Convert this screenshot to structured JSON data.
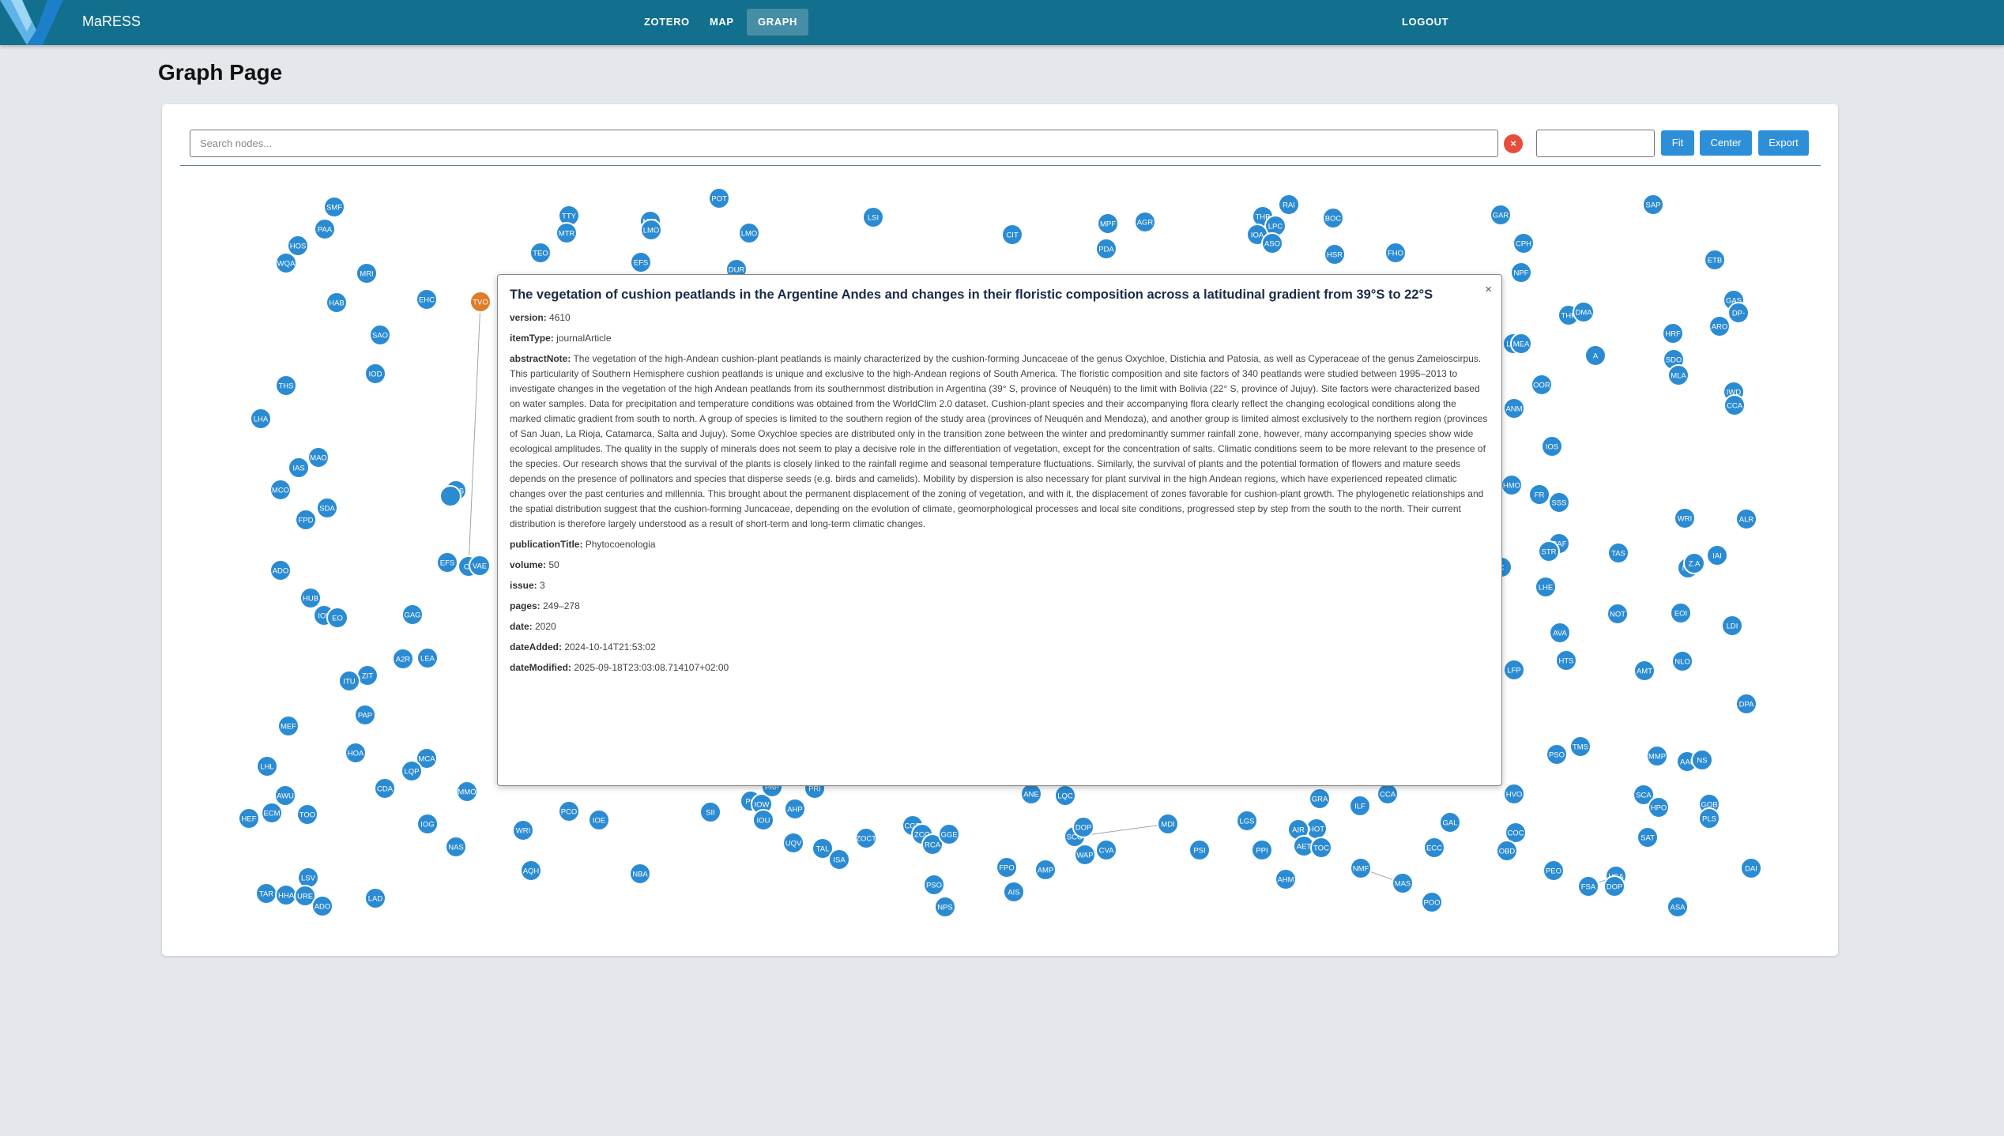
{
  "app": {
    "name": "MaRESS"
  },
  "nav": {
    "zotero": "ZOTERO",
    "map": "MAP",
    "graph": "GRAPH",
    "logout": "LOGOUT"
  },
  "page": {
    "title": "Graph Page"
  },
  "toolbar": {
    "search_placeholder": "Search nodes...",
    "clear": "×",
    "fit": "Fit",
    "center": "Center",
    "export": "Export"
  },
  "colors": {
    "topbar": "#126f8d",
    "node": "#2b8bd2",
    "node_highlight": "#e07b28",
    "button": "#2d8fd8",
    "clear": "#e74c3c"
  },
  "popup": {
    "close": "×",
    "title": "The vegetation of cushion peatlands in the Argentine Andes and changes in their floristic composition across a latitudinal gradient from 39°S to 22°S",
    "fields": [
      {
        "key": "version:",
        "value": "4610"
      },
      {
        "key": "itemType:",
        "value": "journalArticle"
      },
      {
        "key": "abstractNote:",
        "value": "The vegetation of the high-Andean cushion-plant peatlands is mainly characterized by the cushion-forming Juncaceae of the genus Oxychloe, Distichia and Patosia, as well as Cyperaceae of the genus Zameioscirpus. This particularity of Southern Hemisphere cushion peatlands is unique and exclusive to the high-Andean regions of South America. The floristic composition and site factors of 340 peatlands were studied between 1995–2013 to investigate changes in the vegetation of the high Andean peatlands from its southernmost distribution in Argentina (39° S, province of Neuquén) to the limit with Bolivia (22° S, province of Jujuy). Site factors were characterized based on water samples. Data for precipitation and temperature conditions was obtained from the WorldClim 2.0 dataset. Cushion-plant species and their accompanying flora clearly reflect the changing ecological conditions along the marked climatic gradient from south to north. A group of species is limited to the southern region of the study area (provinces of Neuquén and Mendoza), and another group is limited almost exclusively to the northern region (provinces of San Juan, La Rioja, Catamarca, Salta and Jujuy). Some Oxychloe species are distributed only in the transition zone between the winter and predominantly summer rainfall zone, however, many accompanying species show wide ecological amplitudes. The quality in the supply of minerals does not seem to play a decisive role in the differentiation of vegetation, except for the concentration of salts. Climatic conditions seem to be more relevant to the presence of the species. Our research shows that the survival of the plants is closely linked to the rainfall regime and seasonal temperature fluctuations. Similarly, the survival of plants and the potential formation of flowers and mature seeds depends on the presence of pollinators and species that disperse seeds (e.g. birds and camelids). Mobility by dispersion is also necessary for plant survival in the high Andean regions, which have experienced repeated climatic changes over the past centuries and millennia. This brought about the permanent displacement of the zoning of vegetation, and with it, the displacement of zones favorable for cushion-plant growth. The phylogenetic relationships and the spatial distribution suggest that the cushion-forming Juncaceae, depending on the evolution of climate, geomorphological processes and local site conditions, progressed step by step from the south to the north. Their current distribution is therefore largely understood as a result of short-term and long-term climatic changes."
      },
      {
        "key": "publicationTitle:",
        "value": "Phytocoenologia"
      },
      {
        "key": "volume:",
        "value": "50"
      },
      {
        "key": "issue:",
        "value": "3"
      },
      {
        "key": "pages:",
        "value": "249–278"
      },
      {
        "key": "date:",
        "value": "2020"
      },
      {
        "key": "dateAdded:",
        "value": "2024-10-14T21:53:02"
      },
      {
        "key": "dateModified:",
        "value": "2025-09-18T23:03:08.714107+02:00"
      }
    ]
  },
  "graph_nodes": [
    [
      "SMF",
      0,
      0
    ],
    [
      "PAA",
      0,
      0
    ],
    [
      "HOS",
      0,
      0
    ],
    [
      "WQA",
      0,
      0
    ],
    [
      "MRI",
      0,
      0
    ],
    [
      "HAB",
      0,
      0
    ],
    [
      "EHC",
      0,
      0
    ],
    [
      "TVO",
      0,
      0,
      1
    ],
    [
      "SAO",
      0,
      0
    ],
    [
      "IOD",
      0,
      0
    ],
    [
      "THS",
      0,
      0
    ],
    [
      "LHA",
      0,
      0
    ],
    [
      "MAO",
      0,
      0
    ],
    [
      "IAS",
      0,
      0
    ],
    [
      "MCO",
      0,
      0
    ],
    [
      "SDA",
      0,
      0
    ],
    [
      "FPD",
      0,
      0
    ],
    [
      "AOS",
      0,
      0
    ],
    [
      "",
      0,
      0
    ],
    [
      "EFS",
      0,
      0
    ],
    [
      "CL",
      0,
      0
    ],
    [
      "VAE",
      0,
      0
    ],
    [
      "ADO",
      0,
      0
    ],
    [
      "HUB",
      0,
      0
    ],
    [
      "IOL",
      0,
      0
    ],
    [
      "EO",
      0,
      0
    ],
    [
      "GAG",
      0,
      0
    ],
    [
      "A2R",
      0,
      0
    ],
    [
      "LEA",
      0,
      0
    ],
    [
      "ZIT",
      0,
      0
    ],
    [
      "ITU",
      0,
      0
    ],
    [
      "PAP",
      0,
      0
    ],
    [
      "MEF",
      0,
      0
    ],
    [
      "HOA",
      0,
      0
    ],
    [
      "MCA",
      0,
      0
    ],
    [
      "LQP",
      0,
      0
    ],
    [
      "LHL",
      0,
      0
    ],
    [
      "CDA",
      0,
      0
    ],
    [
      "MMO",
      0,
      0
    ],
    [
      "AWU",
      0,
      0
    ],
    [
      "ECM",
      0,
      0
    ],
    [
      "TOO",
      0,
      0
    ],
    [
      "HEF",
      0,
      0
    ],
    [
      "IOG",
      0,
      0
    ],
    [
      "NAS",
      0,
      0
    ],
    [
      "LSV",
      0,
      0
    ],
    [
      "TAR",
      0,
      0
    ],
    [
      "HHA",
      0,
      0
    ],
    [
      "URE",
      0,
      0
    ],
    [
      "ADO",
      0,
      0
    ],
    [
      "LAD",
      0,
      0
    ],
    [
      "WRI",
      0,
      0
    ],
    [
      "AQH",
      0,
      0
    ],
    [
      "PCO",
      0,
      0
    ],
    [
      "IOE",
      0,
      0
    ],
    [
      "NBA",
      0,
      0
    ],
    [
      "SII",
      0,
      0
    ],
    [
      "TTY",
      0,
      0
    ],
    [
      "MTR",
      0,
      0
    ],
    [
      "TEO",
      0,
      0
    ],
    [
      "MTA",
      0,
      0
    ],
    [
      "LMO",
      0,
      0
    ],
    [
      "EFS",
      0,
      0
    ],
    [
      "POT",
      0,
      0
    ],
    [
      "LMO",
      0,
      0
    ],
    [
      "DUR",
      0,
      0
    ],
    [
      "LSI",
      0,
      0
    ],
    [
      "CIT",
      0,
      0
    ],
    [
      "MPF",
      0,
      0
    ],
    [
      "AGR",
      0,
      0
    ],
    [
      "PDA",
      0,
      0
    ],
    [
      "RAI",
      0,
      0
    ],
    [
      "THB",
      0,
      0
    ],
    [
      "LPC",
      0,
      0
    ],
    [
      "IOA",
      0,
      0
    ],
    [
      "ASO",
      0,
      0
    ],
    [
      "BOC",
      0,
      0
    ],
    [
      "HSR",
      0,
      0
    ],
    [
      "FHO",
      0,
      0
    ],
    [
      "GAR",
      0,
      0
    ],
    [
      "CPH",
      0,
      0
    ],
    [
      "NPF",
      0,
      0
    ],
    [
      "SAP",
      0,
      0
    ],
    [
      "ETB",
      0,
      0
    ],
    [
      "GAS",
      0,
      0
    ],
    [
      "DP-",
      0,
      0
    ],
    [
      "THP",
      0,
      0
    ],
    [
      "DMA",
      0,
      0
    ],
    [
      "ARO",
      0,
      0
    ],
    [
      "HRF",
      0,
      0
    ],
    [
      "LLC",
      0,
      0
    ],
    [
      "MEA",
      0,
      0
    ],
    [
      "A",
      0,
      0
    ],
    [
      "SDO",
      0,
      0
    ],
    [
      "MLA",
      0,
      0
    ],
    [
      "OOR",
      0,
      0
    ],
    [
      "IWD",
      0,
      0
    ],
    [
      "CCA",
      0,
      0
    ],
    [
      "ANM",
      0,
      0
    ],
    [
      "IOS",
      0,
      0
    ],
    [
      "HMO",
      0,
      0
    ],
    [
      "FR",
      0,
      0
    ],
    [
      "SSS",
      0,
      0
    ],
    [
      "WRI",
      0,
      0
    ],
    [
      "ALR",
      0,
      0
    ],
    [
      "CAF",
      0,
      0
    ],
    [
      "STR",
      0,
      0
    ],
    [
      "TAS",
      0,
      0
    ],
    [
      "IAI",
      0,
      0
    ],
    [
      "NLI",
      0,
      0
    ],
    [
      "Z.A",
      0,
      0
    ],
    [
      "C",
      0,
      0
    ],
    [
      "LHE",
      0,
      0
    ],
    [
      "NOT",
      0,
      0
    ],
    [
      "EOI",
      0,
      0
    ],
    [
      "AVA",
      0,
      0
    ],
    [
      "LDI",
      0,
      0
    ],
    [
      "HTS",
      0,
      0
    ],
    [
      "LFP",
      0,
      0
    ],
    [
      "AMT",
      0,
      0
    ],
    [
      "NLO",
      0,
      0
    ],
    [
      "DPA",
      0,
      0
    ],
    [
      "PSO",
      0,
      0
    ],
    [
      "TMS",
      0,
      0
    ],
    [
      "MMP",
      0,
      0
    ],
    [
      "AAL",
      0,
      0
    ],
    [
      "NS",
      0,
      0
    ],
    [
      "SCA",
      0,
      0
    ],
    [
      "HPO",
      0,
      0
    ],
    [
      "GOB",
      0,
      0
    ],
    [
      "PLS",
      0,
      0
    ],
    [
      "SAT",
      0,
      0
    ],
    [
      "HVO",
      0,
      0
    ],
    [
      "CCA",
      0,
      0
    ],
    [
      "GRA",
      0,
      0
    ],
    [
      "ILF",
      0,
      0
    ],
    [
      "GAL",
      0,
      0
    ],
    [
      "COC",
      0,
      0
    ],
    [
      "OBD",
      0,
      0
    ],
    [
      "ECC",
      0,
      0
    ],
    [
      "PEO",
      0,
      0
    ],
    [
      "FSA",
      0,
      0
    ],
    [
      "HSA",
      0,
      0
    ],
    [
      "DOP",
      0,
      0
    ],
    [
      "DAI",
      0,
      0
    ],
    [
      "ASA",
      0,
      0
    ],
    [
      "POO",
      0,
      0
    ],
    [
      "MAS",
      0,
      0
    ],
    [
      "NMF",
      0,
      0
    ],
    [
      "AHM",
      0,
      0
    ],
    [
      "HOT",
      0,
      0
    ],
    [
      "AIR",
      0,
      0
    ],
    [
      "AET",
      0,
      0
    ],
    [
      "TOC",
      0,
      0
    ],
    [
      "LGS",
      0,
      0
    ],
    [
      "PPI",
      0,
      0
    ],
    [
      "PSI",
      0,
      0
    ],
    [
      "MDI",
      0,
      0
    ],
    [
      "SCO",
      0,
      0
    ],
    [
      "DOP",
      0,
      0
    ],
    [
      "WAP",
      0,
      0
    ],
    [
      "CVA",
      0,
      0
    ],
    [
      "AMP",
      0,
      0
    ],
    [
      "AIS",
      0,
      0
    ],
    [
      "FPO",
      0,
      0
    ],
    [
      "PSO",
      0,
      0
    ],
    [
      "NPS",
      0,
      0
    ],
    [
      "CGR",
      0,
      0
    ],
    [
      "ZCO",
      0,
      0
    ],
    [
      "RCA",
      0,
      0
    ],
    [
      "GGE",
      0,
      0
    ],
    [
      "ANE",
      0,
      0
    ],
    [
      "LQC",
      0,
      0
    ],
    [
      "PC",
      0,
      0
    ],
    [
      "IOW",
      0,
      0
    ],
    [
      "IOU",
      0,
      0
    ],
    [
      "AHP",
      0,
      0
    ],
    [
      "UQV",
      0,
      0
    ],
    [
      "TAL",
      0,
      0
    ],
    [
      "ISA",
      0,
      0
    ],
    [
      "ZOCT",
      0,
      0
    ],
    [
      "PRI",
      0,
      0
    ],
    [
      "PAP",
      0,
      0
    ]
  ]
}
